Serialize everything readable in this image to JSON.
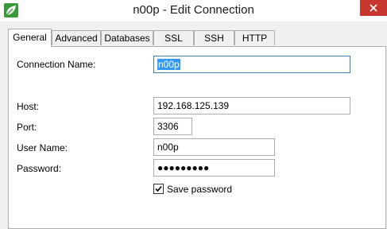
{
  "window": {
    "title": "n00p - Edit Connection"
  },
  "tabs": [
    {
      "label": "General",
      "active": true
    },
    {
      "label": "Advanced",
      "active": false
    },
    {
      "label": "Databases",
      "active": false
    },
    {
      "label": "SSL",
      "active": false
    },
    {
      "label": "SSH",
      "active": false
    },
    {
      "label": "HTTP",
      "active": false
    }
  ],
  "form": {
    "connection_name": {
      "label": "Connection Name:",
      "value": "n00p"
    },
    "host": {
      "label": "Host:",
      "value": "192.168.125.139"
    },
    "port": {
      "label": "Port:",
      "value": "3306"
    },
    "user_name": {
      "label": "User Name:",
      "value": "n00p"
    },
    "password": {
      "label": "Password:",
      "value": "●●●●●●●●●"
    },
    "save_password": {
      "label": "Save password",
      "checked": true
    }
  },
  "colors": {
    "accent": "#3399ff",
    "close": "#c7372f",
    "app_icon": "#3a9a3a"
  },
  "icons": {
    "app": "navicat-leaf-icon",
    "close": "close-icon",
    "check": "checkmark-icon"
  }
}
